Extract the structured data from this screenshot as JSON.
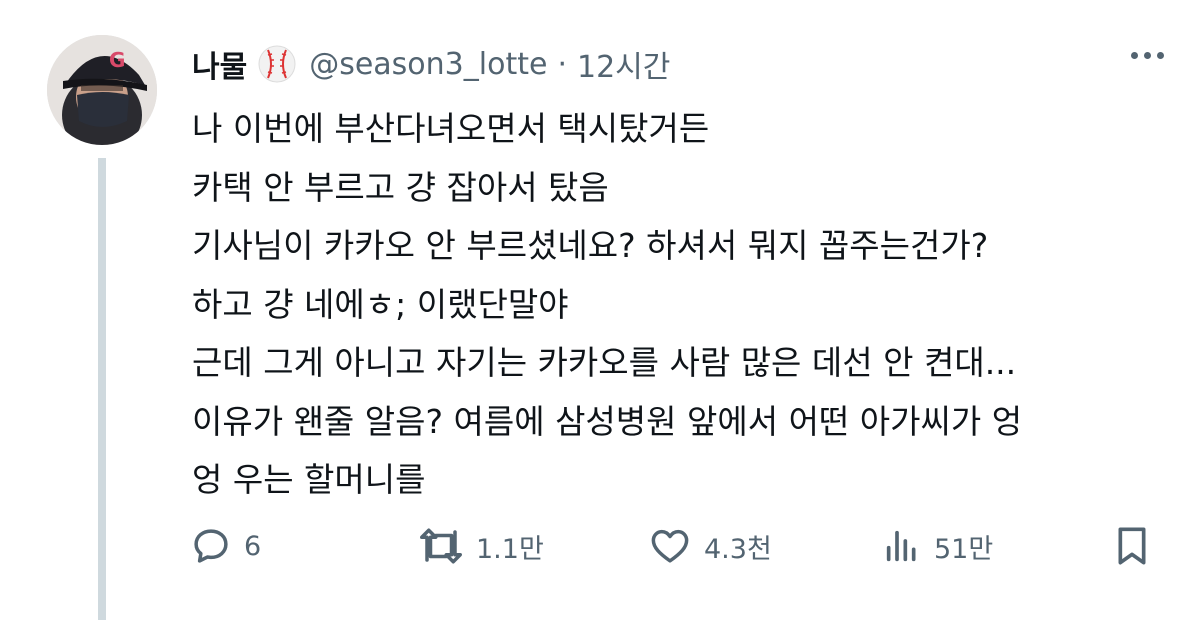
{
  "tweet": {
    "author_name": "나물",
    "handle": "@season3_lotte",
    "separator": "·",
    "time": "12시간",
    "lines": [
      "나 이번에 부산다녀오면서 택시탔거든",
      "카택 안 부르고 걍 잡아서 탔음",
      "기사님이 카카오 안 부르셨네요? 하셔서 뭐지 꼽주는건가?",
      "하고 걍 네에ㅎ; 이랬단말야",
      "근데 그게 아니고 자기는 카카오를 사람 많은 데선 안 켠대...",
      "이유가 왠줄 알음? 여름에 삼성병원 앞에서 어떤 아가씨가 엉",
      "엉 우는 할머니를"
    ]
  },
  "actions": {
    "replies": "6",
    "retweets": "1.1만",
    "likes": "4.3천",
    "views": "51만"
  },
  "icons": {
    "avatar": "avatar-photo",
    "author_badge": "baseball-icon",
    "more": "more-dots-icon",
    "reply": "reply-bubble-icon",
    "retweet": "retweet-arrows-icon",
    "like": "heart-icon",
    "views": "bar-chart-icon",
    "bookmark": "bookmark-icon"
  },
  "colors": {
    "text": "#0f1419",
    "secondary": "#536471",
    "thread_line": "#cfd9de"
  }
}
